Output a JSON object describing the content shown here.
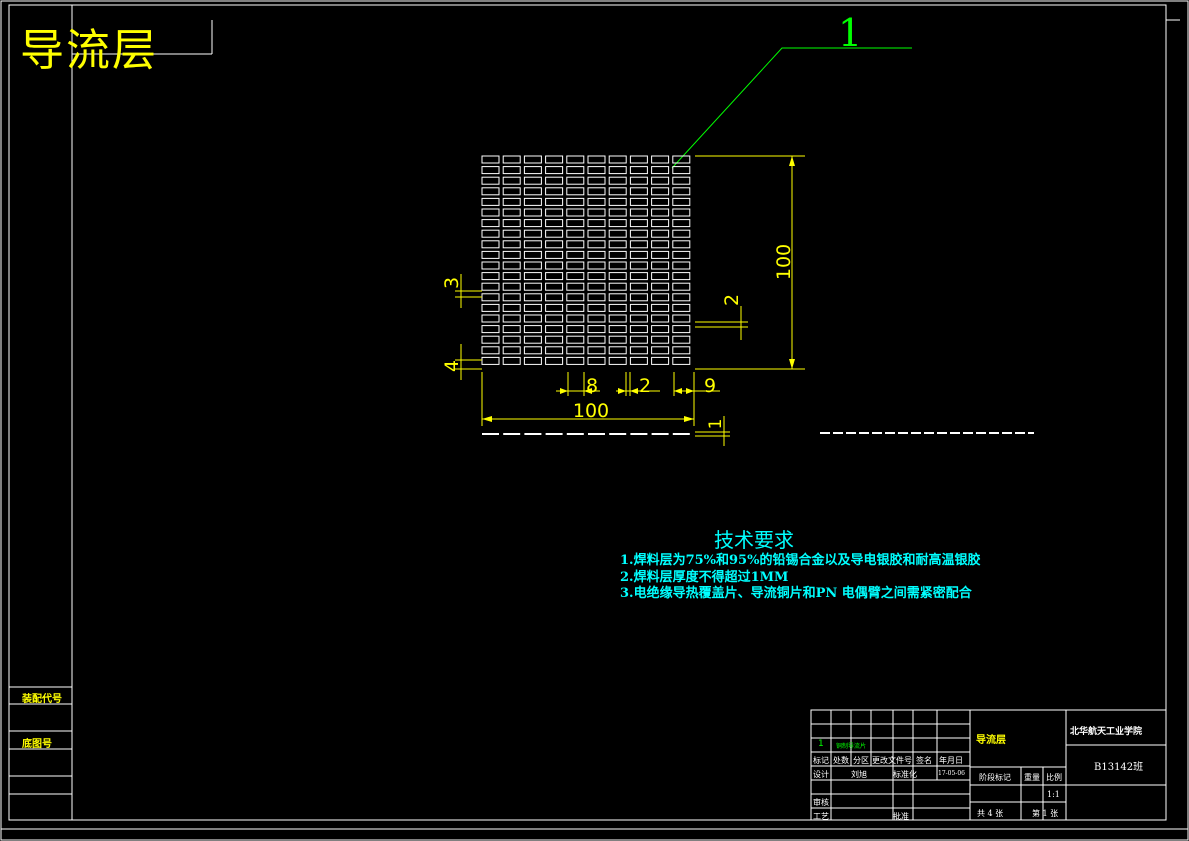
{
  "drawing": {
    "title": "导流层",
    "leader_number": "1"
  },
  "dimensions": {
    "width_total": "100",
    "height_total": "100",
    "cell_width": "8",
    "cell_gap": "2",
    "edge_margin": "9",
    "row_pitch": "3",
    "row_gap": "2",
    "bottom_offset": "4",
    "thickness": "1"
  },
  "tech_requirements": {
    "heading": "技术要求",
    "items": [
      "1.焊料层为75%和95%的铅锡合金以及导电银胶和耐高温银胶",
      "2.焊料层厚度不得超过1MM",
      "3.电绝缘导热覆盖片、导流铜片和PN 电偶臂之间需紧密配合"
    ]
  },
  "side_panel": {
    "assembly_code": "装配代号",
    "base_drawing": "底图号"
  },
  "title_block": {
    "part_name": "导流层",
    "school": "北华航天工业学院",
    "drawing_code": "B13142班",
    "row_number": "1",
    "row_material": "铜制导流片",
    "col_mark": "标记",
    "col_count": "处数",
    "col_zone": "分区",
    "col_change_doc": "更改文件号",
    "col_sign": "签名",
    "col_date": "年月日",
    "design_label": "设计",
    "designer": "刘旭",
    "standard_label": "标准化",
    "date_value": "17-05-06",
    "review_label": "审核",
    "process_label": "工艺",
    "approve_label": "批准",
    "stage_label": "阶段标记",
    "weight_label": "重量",
    "scale_label": "比例",
    "scale_value": "1:1",
    "sheet_total": "共 4 张",
    "sheet_current": "第 1 张"
  },
  "colors": {
    "background": "#000000",
    "drawing_lines": "#ffffff",
    "dimension": "#ffff00",
    "text_cyan": "#00ffff",
    "leader": "#00ff00"
  }
}
